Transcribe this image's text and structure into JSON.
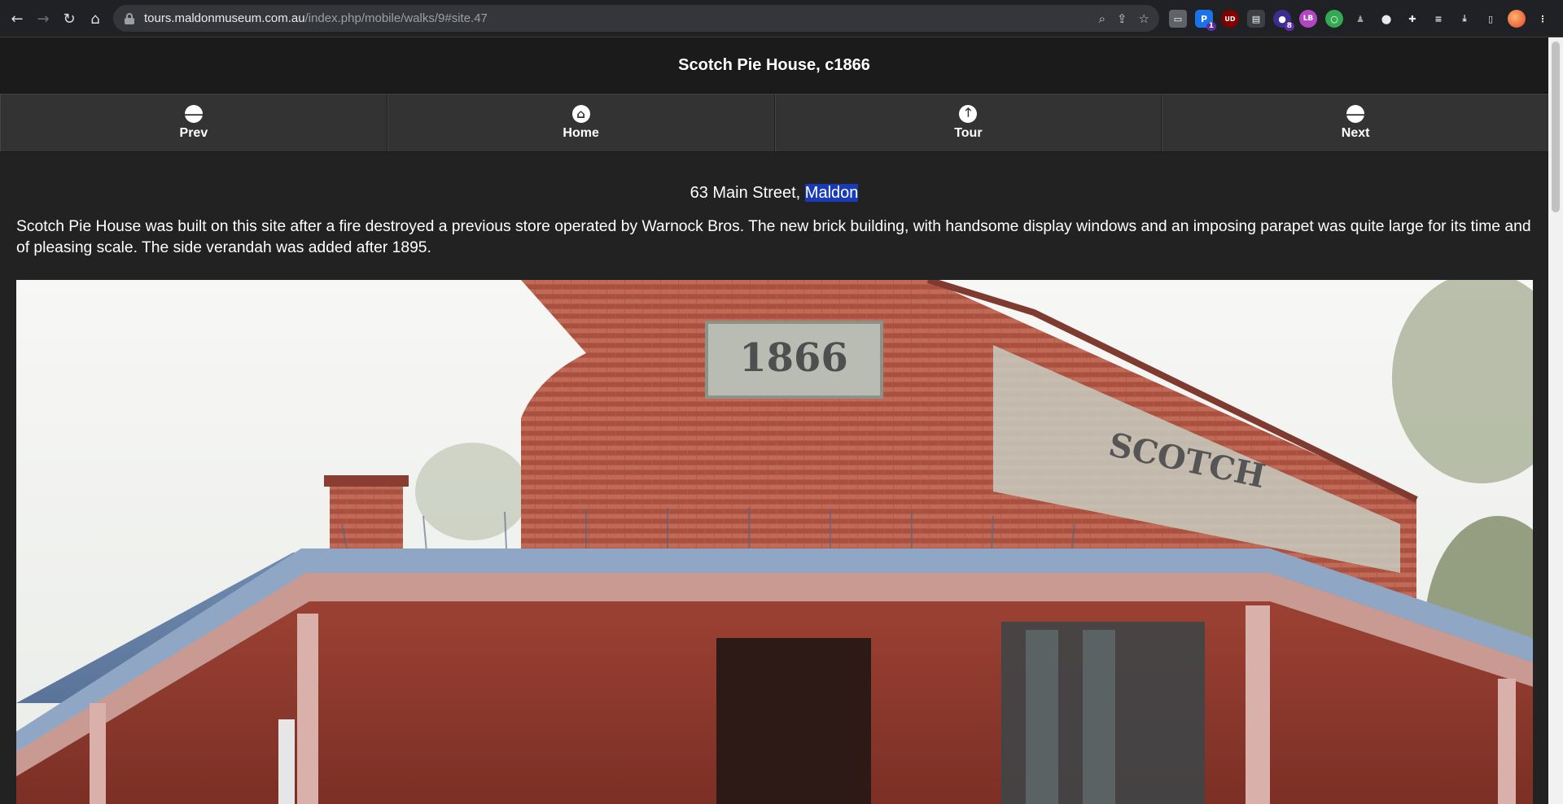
{
  "browser": {
    "url_host": "tours.maldonmuseum.com.au",
    "url_path": "/index.php/mobile/walks/9#site.47",
    "extension_badges": [
      "1",
      "8"
    ],
    "extension_labels": [
      "UD",
      "LB"
    ]
  },
  "header": {
    "title": "Scotch Pie House, c1866"
  },
  "nav": [
    {
      "label": "Prev",
      "icon": "arrow-left-icon"
    },
    {
      "label": "Home",
      "icon": "home-icon"
    },
    {
      "label": "Tour",
      "icon": "arrow-up-icon"
    },
    {
      "label": "Next",
      "icon": "arrow-right-icon"
    }
  ],
  "site": {
    "address_prefix": "63 Main Street, ",
    "address_town": "Maldon",
    "description": "Scotch Pie House was built on this site after a fire destroyed a previous store operated by Warnock Bros. The new brick building, with handsome display windows and an imposing parapet was quite large for its time and of pleasing scale. The side verandah was added after 1895.",
    "photo_year": "1866",
    "photo_sign": "SCOTCH"
  }
}
